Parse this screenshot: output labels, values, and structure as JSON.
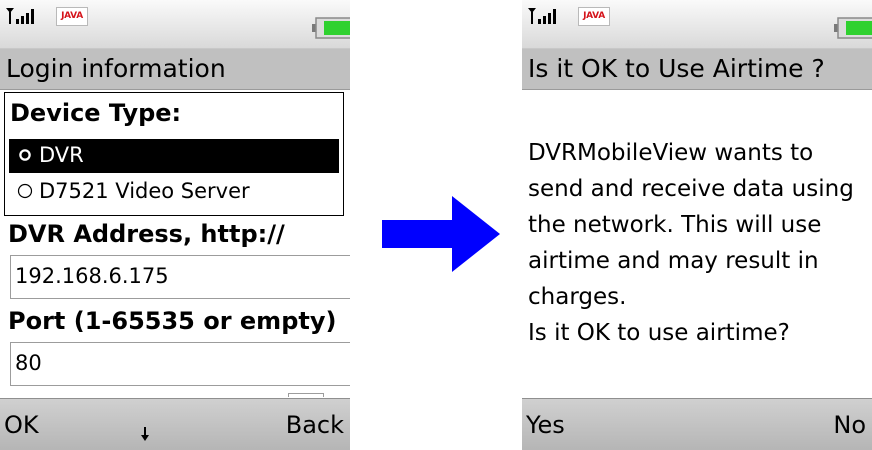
{
  "colors": {
    "selection": "#000000",
    "title_bar": "#c0c0c0",
    "softkey_bar": "#c4c4c4",
    "battery_fill": "#2fd12f",
    "java_red": "#d5141b",
    "arrow_blue": "#0000ff"
  },
  "icons": {
    "signal": "signal-strength-icon",
    "java": "java-icon",
    "battery": "battery-icon",
    "radio_on": "radio-selected-icon",
    "radio_off": "radio-unselected-icon",
    "scroll": "scroll-down-arrow-icon",
    "transition": "right-arrow-icon"
  },
  "left_phone": {
    "status": {
      "java_label": "JAVA"
    },
    "title": "Login information",
    "device_type": {
      "label": "Device Type:",
      "options": [
        {
          "label": "DVR",
          "selected": true
        },
        {
          "label": "D7521 Video Server",
          "selected": false
        }
      ]
    },
    "dvr_address": {
      "label": "DVR Address, http://",
      "value": "192.168.6.175"
    },
    "port": {
      "label": "Port (1-65535 or empty)",
      "value": "80"
    },
    "softkeys": {
      "left": "OK",
      "right": "Back"
    }
  },
  "right_phone": {
    "status": {
      "java_label": "JAVA"
    },
    "title": "Is it OK to Use Airtime ?",
    "message": "DVRMobileView wants to send and receive data using the network. This will use airtime and may result in charges.",
    "question": "Is it OK to use airtime?",
    "softkeys": {
      "left": "Yes",
      "right": "No"
    }
  }
}
